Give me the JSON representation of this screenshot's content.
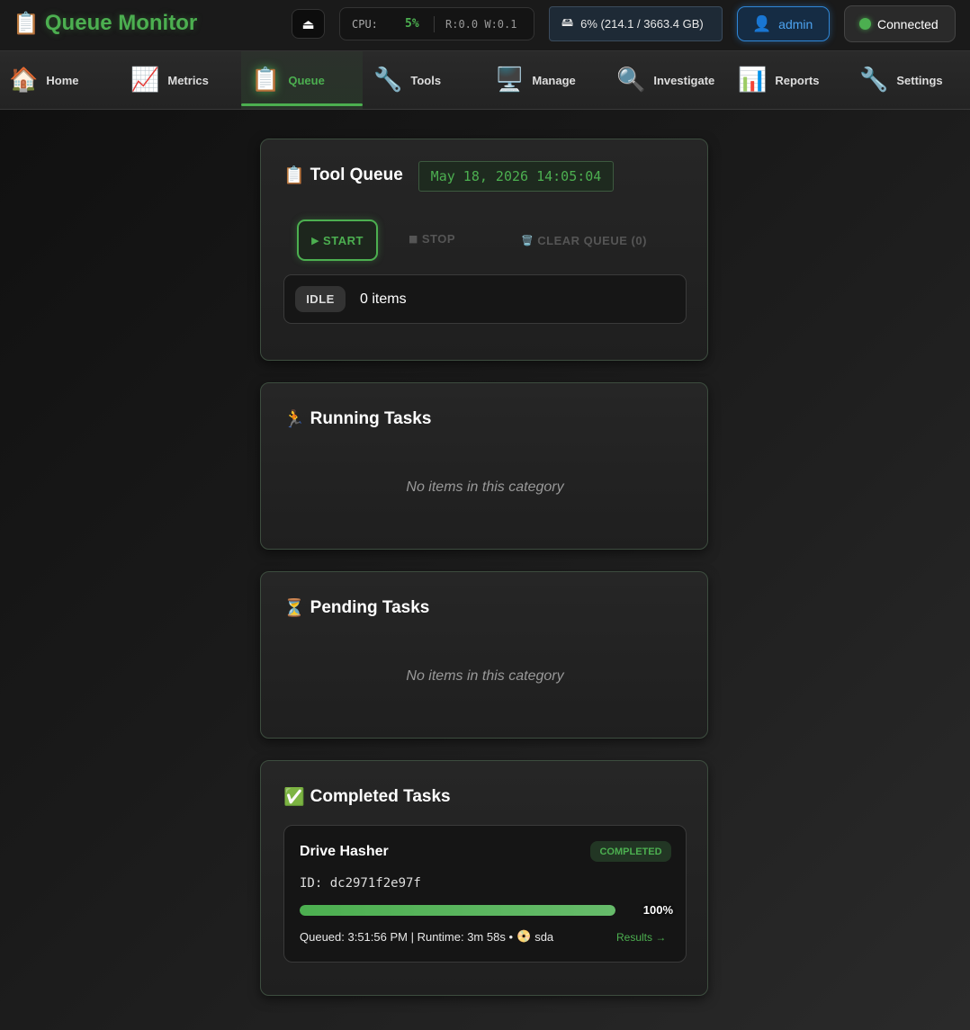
{
  "app": {
    "title": "Queue Monitor",
    "logo_icon": "clipboard-icon",
    "logo_glyph": "📋"
  },
  "header": {
    "eject_glyph": "⏏",
    "cpu": {
      "label": "CPU:",
      "value": "5%",
      "io": "R:0.0 W:0.1"
    },
    "disk": {
      "glyph": "🖴",
      "text": "6% (214.1 / 3663.4 GB)"
    },
    "user": {
      "glyph": "👤",
      "name": "admin"
    },
    "connection": {
      "status": "Connected",
      "color": "#4caf50"
    }
  },
  "nav": {
    "active": "Queue",
    "items": [
      {
        "label": "Home",
        "glyph": "🏠",
        "icon": "home-icon"
      },
      {
        "label": "Metrics",
        "glyph": "📈",
        "icon": "chart-up-icon"
      },
      {
        "label": "Queue",
        "glyph": "📋",
        "icon": "clipboard-icon"
      },
      {
        "label": "Tools",
        "glyph": "🔧",
        "icon": "wrench-icon"
      },
      {
        "label": "Manage",
        "glyph": "🖥️",
        "icon": "monitor-icon"
      },
      {
        "label": "Investigate",
        "glyph": "🔍",
        "icon": "magnifier-icon"
      },
      {
        "label": "Reports",
        "glyph": "📊",
        "icon": "bar-chart-icon"
      },
      {
        "label": "Settings",
        "glyph": "🔧",
        "icon": "wrench-icon"
      }
    ]
  },
  "tool_queue": {
    "title_glyph": "📋",
    "title": "Tool Queue",
    "timestamp": "May 18, 2026 14:05:04",
    "start_glyph": "▶",
    "start_label": "START",
    "stop_glyph": "■",
    "stop_label": "STOP",
    "clear_glyph": "🗑️",
    "clear_label": "CLEAR QUEUE (0)",
    "status_badge": "IDLE",
    "items_count": "0 items"
  },
  "running": {
    "title_glyph": "🏃",
    "title": "Running Tasks",
    "empty": "No items in this category"
  },
  "pending": {
    "title_glyph": "⏳",
    "title": "Pending Tasks",
    "empty": "No items in this category"
  },
  "completed": {
    "title_glyph": "✅",
    "title": "Completed Tasks",
    "tasks": [
      {
        "name": "Drive Hasher",
        "status": "COMPLETED",
        "id": "ID: dc2971f2e97f",
        "progress": "100%",
        "progress_value": 100,
        "meta": "Queued: 3:51:56 PM | Runtime: 3m 58s •",
        "disc_glyph": "📀",
        "device": "sda",
        "results_link": "Results →"
      }
    ]
  },
  "colors": {
    "accent": "#4caf50",
    "user_accent": "#4da3f0"
  }
}
